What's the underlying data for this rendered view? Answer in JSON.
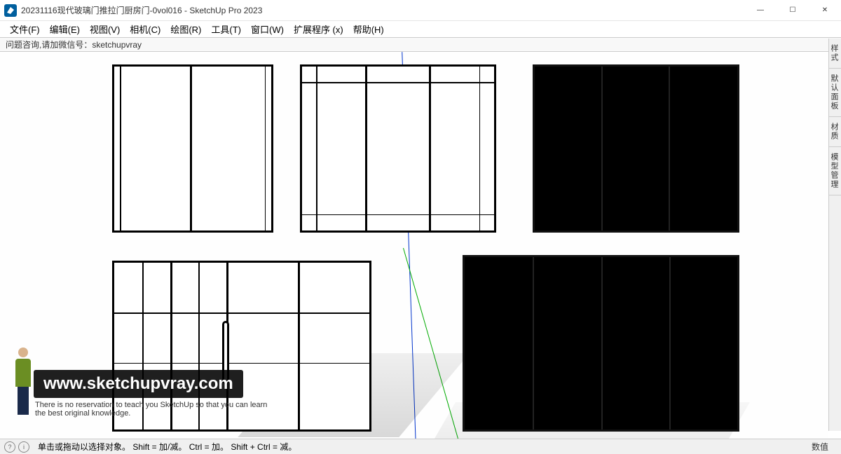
{
  "window": {
    "doc_title": "20231116现代玻璃门推拉门厨房门-0vol016",
    "app_name": "SketchUp Pro 2023",
    "title_sep": " - "
  },
  "win_controls": {
    "min": "—",
    "max": "☐",
    "close": "✕"
  },
  "menus": [
    "文件(F)",
    "编辑(E)",
    "视图(V)",
    "相机(C)",
    "绘图(R)",
    "工具(T)",
    "窗口(W)",
    "扩展程序 (x)",
    "帮助(H)"
  ],
  "info_bar": "问题咨询,请加微信号：sketchupvray",
  "side_tabs": [
    "样式",
    "默认面板",
    "材质",
    "模型管理"
  ],
  "status": {
    "hint": "单击或拖动以选择对象。 Shift = 加/减。 Ctrl = 加。 Shift + Ctrl = 减。",
    "value_label": "数值"
  },
  "watermark": {
    "url": "www.sketchupvray.com",
    "sub1": "There is no reservation to teach you SketchUp so that you can learn",
    "sub2": "the best original knowledge."
  }
}
